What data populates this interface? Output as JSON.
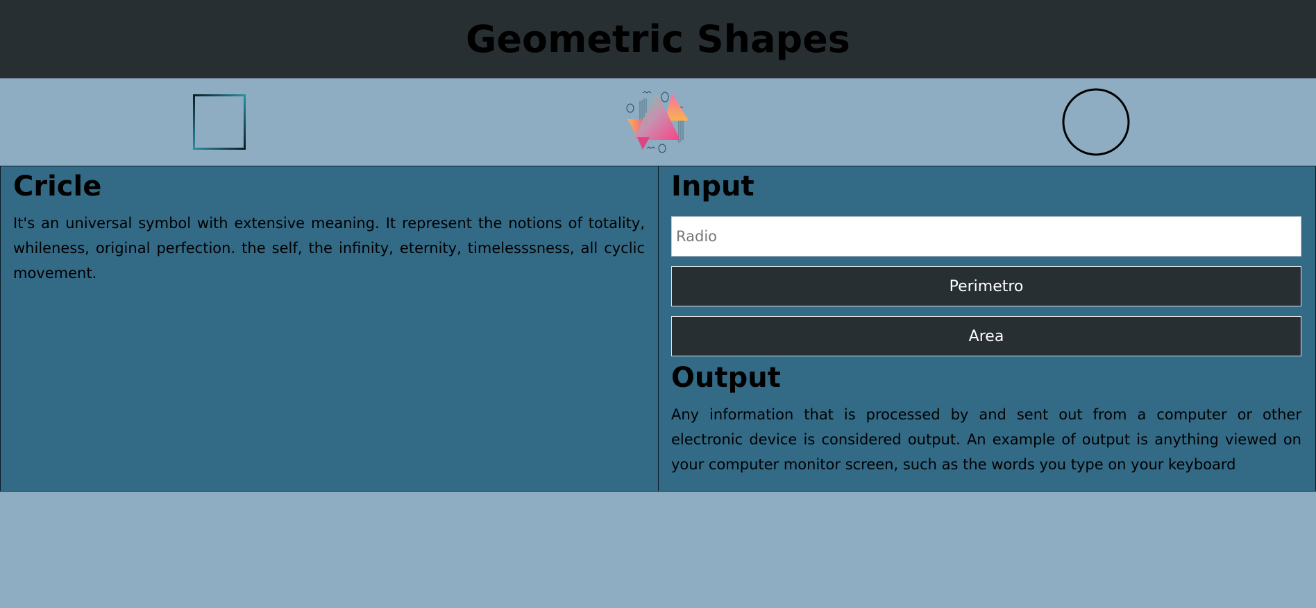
{
  "header": {
    "title": "Geometric Shapes"
  },
  "shapes": {
    "square_icon": "square-icon",
    "triangle_icon": "triangle-art-icon",
    "circle_icon": "circle-icon"
  },
  "left_panel": {
    "title": "Cricle",
    "text": "It's an universal symbol with extensive meaning. It represent the notions of totality, whileness, original perfection. the self, the infinity, eternity, timelesssness, all cyclic movement."
  },
  "right_panel": {
    "input_title": "Input",
    "radio_placeholder": "Radio",
    "radio_value": "",
    "perimetro_label": "Perimetro",
    "area_label": "Area",
    "output_title": "Output",
    "output_text": "Any information that is processed by and sent out from a computer or other electronic device is considered output. An example of output is anything viewed on your computer monitor screen, such as the words you type on your keyboard"
  },
  "colors": {
    "header_bg": "#282f33",
    "page_bg": "#8eadc3",
    "panel_bg": "#336a86",
    "button_bg": "#282f33"
  }
}
